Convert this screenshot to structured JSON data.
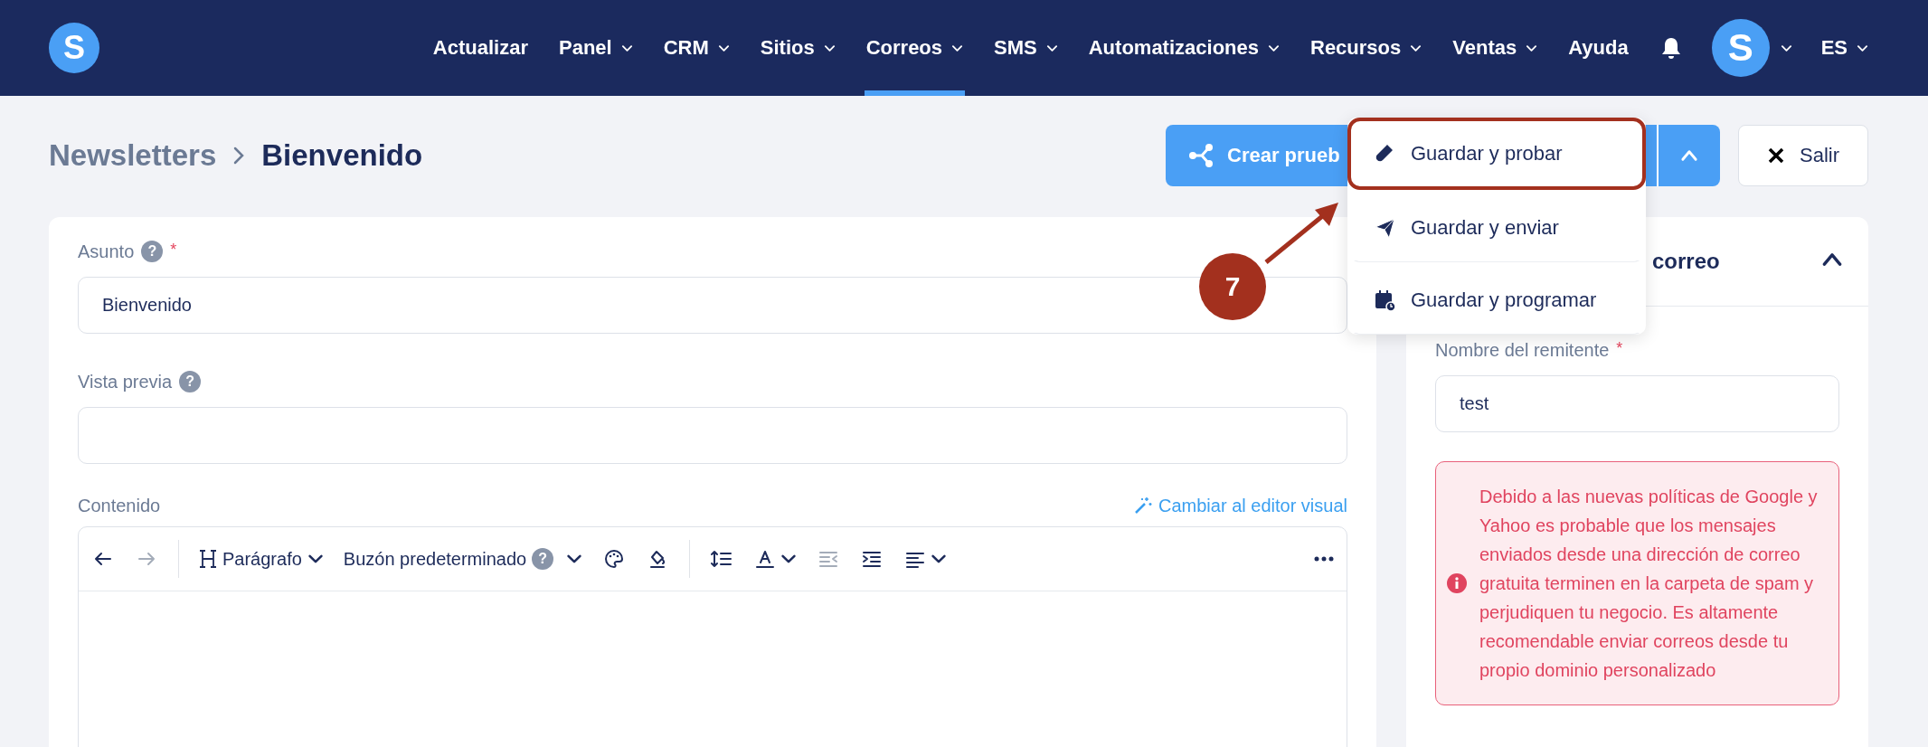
{
  "nav": {
    "logo_letter": "S",
    "items": [
      {
        "label": "Actualizar",
        "has_menu": false,
        "selected": false
      },
      {
        "label": "Panel",
        "has_menu": true,
        "selected": false
      },
      {
        "label": "CRM",
        "has_menu": true,
        "selected": false
      },
      {
        "label": "Sitios",
        "has_menu": true,
        "selected": false
      },
      {
        "label": "Correos",
        "has_menu": true,
        "selected": true
      },
      {
        "label": "SMS",
        "has_menu": true,
        "selected": false
      },
      {
        "label": "Automatizaciones",
        "has_menu": true,
        "selected": false
      },
      {
        "label": "Recursos",
        "has_menu": true,
        "selected": false
      },
      {
        "label": "Ventas",
        "has_menu": true,
        "selected": false
      },
      {
        "label": "Ayuda",
        "has_menu": false,
        "selected": false
      }
    ],
    "avatar_letter": "S",
    "language": "ES"
  },
  "breadcrumb": {
    "parent": "Newsletters",
    "current": "Bienvenido"
  },
  "actions": {
    "primary_label": "Crear prueb",
    "exit_label": "Salir"
  },
  "save_menu": {
    "items": [
      {
        "label": "Guardar y probar",
        "highlighted": true
      },
      {
        "label": "Guardar y enviar",
        "highlighted": false
      },
      {
        "label": "Guardar y programar",
        "highlighted": false
      }
    ]
  },
  "annotation": {
    "number": "7"
  },
  "form": {
    "fields": [
      {
        "label": "Asunto",
        "help_icon": "?",
        "required_mark": "*",
        "value": "Bienvenido"
      },
      {
        "label": "Vista previa",
        "help_icon": "?"
      }
    ],
    "content_label": "Contenido",
    "editor_switch_link": "Cambiar al editor visual",
    "toolbar": [
      {
        "kind": "button",
        "disabled": false
      },
      {
        "kind": "button",
        "disabled": true
      },
      {
        "kind": "divider"
      },
      {
        "kind": "select",
        "label": "Parágrafo"
      },
      {
        "kind": "select",
        "label": "Buzón predeterminado",
        "help_icon": "?"
      },
      {
        "kind": "dropdown",
        "disabled": false
      },
      {
        "kind": "button",
        "disabled": false
      },
      {
        "kind": "button",
        "disabled": false
      },
      {
        "kind": "divider"
      },
      {
        "kind": "button",
        "disabled": false
      },
      {
        "kind": "dropdown",
        "disabled": false
      },
      {
        "kind": "button",
        "disabled": true
      },
      {
        "kind": "button",
        "disabled": false
      },
      {
        "kind": "dropdown",
        "disabled": false
      },
      {
        "kind": "more",
        "disabled": false
      }
    ]
  },
  "side_panel": {
    "title": "correo",
    "expanded": true,
    "sender_label": "Nombre del remitente",
    "sender_required_mark": "*",
    "sender_value": "test",
    "alert": "Debido a las nuevas políticas de Google y Yahoo es probable que los mensajes enviados desde una dirección de correo gratuita terminen en la carpeta de spam y perjudiquen tu negocio. Es altamente recomendable enviar correos desde tu propio dominio personalizado"
  }
}
